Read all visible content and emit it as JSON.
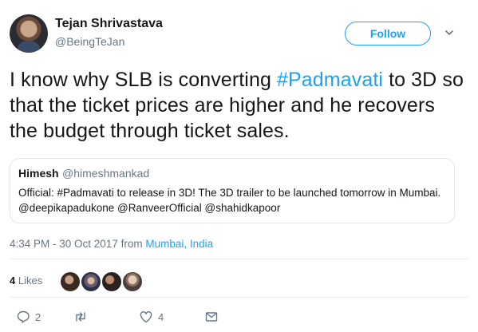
{
  "author": {
    "name": "Tejan Shrivastava",
    "handle": "@BeingTeJan",
    "follow_label": "Follow"
  },
  "tweet": {
    "text_before": "I know why SLB is converting ",
    "hashtag": "#Padmavati",
    "text_after": " to 3D so that the ticket prices are higher and he recovers the budget through ticket sales."
  },
  "quote": {
    "name": "Himesh",
    "handle": "@himeshmankad",
    "text": "Official: #Padmavati to release in 3D! The 3D trailer to be launched tomorrow in Mumbai. @deepikapadukone @RanveerOfficial @shahidkapoor"
  },
  "meta": {
    "time": "4:34 PM - 30 Oct 2017",
    "from": "from",
    "location": "Mumbai, India"
  },
  "engagement": {
    "likes_count": "4",
    "likes_label": "Likes"
  },
  "actions": {
    "reply_count": "2",
    "retweet_count": "",
    "like_count": "4"
  },
  "colors": {
    "accent": "#1da1f2",
    "muted": "#657786",
    "text": "#14171a",
    "border": "#e1e8ed"
  },
  "icons": [
    "caret-down-icon",
    "reply-icon",
    "retweet-icon",
    "like-icon",
    "message-icon"
  ]
}
